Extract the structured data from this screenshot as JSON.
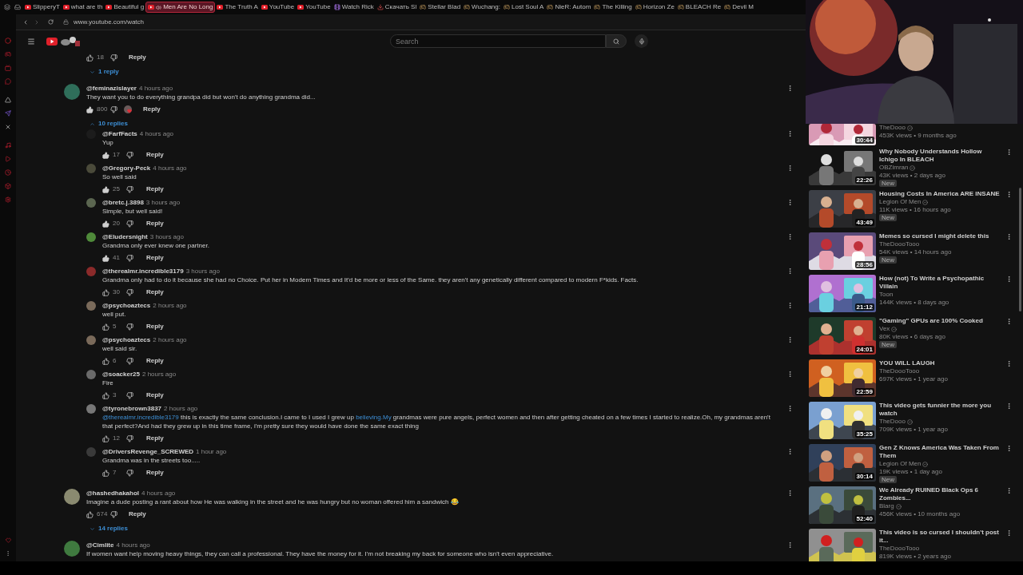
{
  "browser": {
    "tabs": [
      {
        "title": "SlipperyT",
        "kind": "youtube",
        "selected": false,
        "playing": false
      },
      {
        "title": "what are th",
        "kind": "youtube",
        "selected": false,
        "playing": false
      },
      {
        "title": "Beautiful g",
        "kind": "youtube",
        "selected": false,
        "playing": false
      },
      {
        "title": "Men Are No Long",
        "kind": "youtube",
        "selected": true,
        "playing": true
      },
      {
        "title": "The Truth A",
        "kind": "youtube",
        "selected": false,
        "playing": false
      },
      {
        "title": "YouTube",
        "kind": "youtube",
        "selected": false,
        "playing": false
      },
      {
        "title": "YouTube",
        "kind": "youtube",
        "selected": false,
        "playing": false
      },
      {
        "title": "Watch Rick",
        "kind": "video",
        "selected": false,
        "playing": false
      },
      {
        "title": "Скачать Sl",
        "kind": "download",
        "selected": false,
        "playing": false
      },
      {
        "title": "Stellar Blad",
        "kind": "game",
        "selected": false,
        "playing": false
      },
      {
        "title": "Wuchang:",
        "kind": "game",
        "selected": false,
        "playing": false
      },
      {
        "title": "Lost Soul A",
        "kind": "game",
        "selected": false,
        "playing": false
      },
      {
        "title": "NieR: Autom",
        "kind": "game",
        "selected": false,
        "playing": false
      },
      {
        "title": "The Killing",
        "kind": "game",
        "selected": false,
        "playing": false
      },
      {
        "title": "Horizon Ze",
        "kind": "game",
        "selected": false,
        "playing": false
      },
      {
        "title": "BLEACH Re",
        "kind": "game",
        "selected": false,
        "playing": false
      },
      {
        "title": "Devil M",
        "kind": "game",
        "selected": false,
        "playing": false
      }
    ],
    "address": "www.youtube.com/watch"
  },
  "header": {
    "search": {
      "placeholder": "Search"
    }
  },
  "comments": {
    "previous": {
      "likes": "18",
      "liked": false,
      "reply_label": "Reply",
      "toggle": {
        "label": "1 reply",
        "expanded": false
      }
    },
    "threads": [
      {
        "handle": "@feminazislayer",
        "time": "4 hours ago",
        "text": "They want you to do everything grandpa did but won't do anything grandma did...",
        "likes": "800",
        "liked": true,
        "hearted": true,
        "reply_label": "Reply",
        "color": "#2f6e5a",
        "toggle": {
          "label": "10 replies",
          "expanded": true
        },
        "replies": [
          {
            "handle": "@FarfFacts",
            "time": "4 hours ago",
            "text": "Yup",
            "likes": "17",
            "liked": true,
            "reply_label": "Reply",
            "color": "#1c1c1c"
          },
          {
            "handle": "@Gregory-Peck",
            "time": "4 hours ago",
            "text": "So well said",
            "likes": "25",
            "liked": true,
            "reply_label": "Reply",
            "color": "#4a4a3a"
          },
          {
            "handle": "@bretc.j.3898",
            "time": "3 hours ago",
            "text": "Simple, but well said!",
            "likes": "20",
            "liked": true,
            "reply_label": "Reply",
            "color": "#5b6650"
          },
          {
            "handle": "@Eludersnight",
            "time": "3 hours ago",
            "text": "Grandma only ever knew one partner.",
            "likes": "41",
            "liked": true,
            "reply_label": "Reply",
            "color": "#4f8a3a"
          },
          {
            "handle": "@therealmr.incredible3179",
            "time": "3 hours ago",
            "text": "Grandma only had to do it because she had no Choice. Put her in Modern Times and It'd be more or less of the Same. they aren't any genetically different compared to modern F*kids. Facts.",
            "likes": "30",
            "liked": false,
            "reply_label": "Reply",
            "color": "#8b2a2a"
          },
          {
            "handle": "@psychoaztecs",
            "time": "2 hours ago",
            "text": "well put.",
            "likes": "5",
            "liked": false,
            "reply_label": "Reply",
            "color": "#7a6a5a"
          },
          {
            "handle": "@psychoaztecs",
            "time": "2 hours ago",
            "text": "well said sir.",
            "likes": "6",
            "liked": false,
            "reply_label": "Reply",
            "color": "#7a6a5a"
          },
          {
            "handle": "@soacker25",
            "time": "2 hours ago",
            "text": "Fire",
            "likes": "3",
            "liked": false,
            "reply_label": "Reply",
            "color": "#6a6a6a"
          },
          {
            "handle": "@tyronebrown3837",
            "time": "2 hours ago",
            "segments": [
              {
                "kind": "link",
                "text": "@therealmr.incredible3179"
              },
              {
                "kind": "plain",
                "text": " this is exactly the same conclusion.I came to I used I grew up "
              },
              {
                "kind": "link",
                "text": "believing.My"
              },
              {
                "kind": "plain",
                "text": " grandmas were pure angels, perfect women and then after getting cheated on a few times I started to realize.Oh, my grandmas aren't that perfect?And had they grew up in this time frame, i'm pretty sure they would have done the same exact thing"
              }
            ],
            "likes": "12",
            "liked": false,
            "reply_label": "Reply",
            "color": "#777777"
          },
          {
            "handle": "@DriversRevenge_SCREWED",
            "time": "1 hour ago",
            "text": "Grandma was in the streets too.....",
            "likes": "7",
            "liked": false,
            "reply_label": "Reply",
            "color": "#3a3a3a"
          }
        ]
      },
      {
        "handle": "@hashedhakahol",
        "time": "4 hours ago",
        "text": "Imagine a dude posting a rant about how He was walking in the street and he was hungry but no woman offered him a sandwich 😂",
        "likes": "674",
        "liked": false,
        "hearted": false,
        "reply_label": "Reply",
        "color": "#8a8a70",
        "toggle": {
          "label": "14 replies",
          "expanded": false
        }
      },
      {
        "handle": "@Cimlite",
        "time": "4 hours ago",
        "text": "If women want help moving heavy things, they can call a professional. They have the money for it. I'm not breaking my back for someone who isn't even appreciative.",
        "color": "#3f7a3f"
      }
    ]
  },
  "sidebar": {
    "videos": [
      {
        "channel": "TheDooo",
        "verified": true,
        "meta": "453K views • 9 months ago",
        "new": false,
        "duration": "30:44"
      },
      {
        "title": "Why Nobody Understands Hollow Ichigo In BLEACH",
        "channel": "OBZimran",
        "verified": true,
        "meta": "43K views • 2 days ago",
        "new": true,
        "new_label": "New",
        "duration": "22:26"
      },
      {
        "title": "Housing Costs In America ARE INSANE",
        "channel": "Legion Of Men",
        "verified": true,
        "meta": "11K views • 16 hours ago",
        "new": true,
        "new_label": "New",
        "duration": "43:49"
      },
      {
        "title": "Memes so cursed I might delete this",
        "channel": "TheDoooTooo",
        "verified": false,
        "meta": "54K views • 14 hours ago",
        "new": true,
        "new_label": "New",
        "duration": "28:56"
      },
      {
        "title": "How (not) To Write a Psychopathic Villain",
        "channel": "Toon",
        "verified": false,
        "meta": "144K views • 8 days ago",
        "new": false,
        "duration": "21:12"
      },
      {
        "title": "\"Gaming\" GPUs are 100% Cooked",
        "channel": "Vex",
        "verified": true,
        "meta": "80K views • 6 days ago",
        "new": true,
        "new_label": "New",
        "duration": "24:01"
      },
      {
        "title": "YOU WILL LAUGH",
        "channel": "TheDoooTooo",
        "verified": false,
        "meta": "697K views • 1 year ago",
        "new": false,
        "duration": "22:59"
      },
      {
        "title": "This video gets funnier the more you watch",
        "channel": "TheDooo",
        "verified": true,
        "meta": "709K views • 1 year ago",
        "new": false,
        "duration": "35:25"
      },
      {
        "title": "Gen Z  Knows America Was Taken From Them",
        "channel": "Legion Of Men",
        "verified": true,
        "meta": "19K views • 1 day ago",
        "new": true,
        "new_label": "New",
        "duration": "30:14"
      },
      {
        "title": "We Already RUINED Black Ops 6 Zombies...",
        "channel": "Blarg",
        "verified": true,
        "meta": "456K views • 10 months ago",
        "new": false,
        "duration": "52:40"
      },
      {
        "title": "This video is so cursed I shouldn't post it...",
        "channel": "TheDoooTooo",
        "verified": false,
        "meta": "819K views • 2 years ago",
        "new": false
      }
    ]
  }
}
